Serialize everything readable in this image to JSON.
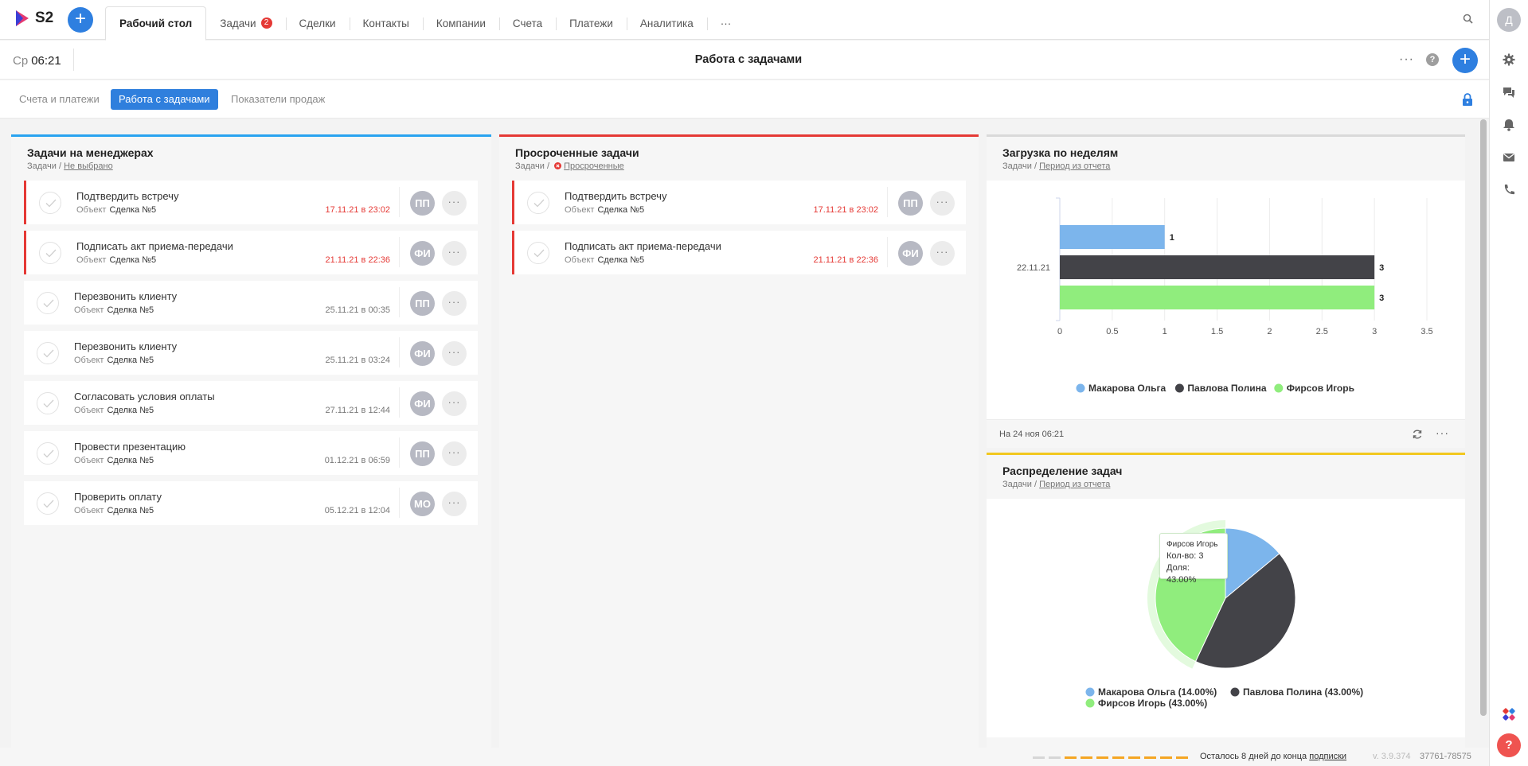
{
  "app": {
    "logo_text": "S2"
  },
  "nav": {
    "tabs": [
      {
        "label": "Рабочий стол"
      },
      {
        "label": "Задачи",
        "badge": "2"
      },
      {
        "label": "Сделки"
      },
      {
        "label": "Контакты"
      },
      {
        "label": "Компании"
      },
      {
        "label": "Счета"
      },
      {
        "label": "Платежи"
      },
      {
        "label": "Аналитика"
      },
      {
        "label": "···"
      }
    ],
    "user_initial": "Д"
  },
  "header": {
    "day": "Ср",
    "time": "06:21",
    "title": "Работа с задачами"
  },
  "subtabs": [
    "Счета и платежи",
    "Работа с задачами",
    "Показатели продаж"
  ],
  "panel_managers": {
    "title": "Задачи на менеджерах",
    "crumb": "Задачи /",
    "filter": "Не выбрано",
    "tasks": [
      {
        "name": "Подтвердить встречу",
        "obj_label": "Объект",
        "obj": "Сделка №5",
        "date": "17.11.21 в 23:02",
        "avatar": "ПП",
        "overdue": true
      },
      {
        "name": "Подписать акт приема-передачи",
        "obj_label": "Объект",
        "obj": "Сделка №5",
        "date": "21.11.21 в 22:36",
        "avatar": "ФИ",
        "overdue": true
      },
      {
        "name": "Перезвонить клиенту",
        "obj_label": "Объект",
        "obj": "Сделка №5",
        "date": "25.11.21 в 00:35",
        "avatar": "ПП",
        "overdue": false
      },
      {
        "name": "Перезвонить клиенту",
        "obj_label": "Объект",
        "obj": "Сделка №5",
        "date": "25.11.21 в 03:24",
        "avatar": "ФИ",
        "overdue": false
      },
      {
        "name": "Согласовать условия оплаты",
        "obj_label": "Объект",
        "obj": "Сделка №5",
        "date": "27.11.21 в 12:44",
        "avatar": "ФИ",
        "overdue": false
      },
      {
        "name": "Провести презентацию",
        "obj_label": "Объект",
        "obj": "Сделка №5",
        "date": "01.12.21 в 06:59",
        "avatar": "ПП",
        "overdue": false
      },
      {
        "name": "Проверить оплату",
        "obj_label": "Объект",
        "obj": "Сделка №5",
        "date": "05.12.21 в 12:04",
        "avatar": "МО",
        "overdue": false
      }
    ]
  },
  "panel_overdue": {
    "title": "Просроченные задачи",
    "crumb": "Задачи /",
    "filter": "Просроченные",
    "tasks": [
      {
        "name": "Подтвердить встречу",
        "obj_label": "Объект",
        "obj": "Сделка №5",
        "date": "17.11.21 в 23:02",
        "avatar": "ПП",
        "overdue": true
      },
      {
        "name": "Подписать акт приема-передачи",
        "obj_label": "Объект",
        "obj": "Сделка №5",
        "date": "21.11.21 в 22:36",
        "avatar": "ФИ",
        "overdue": true
      }
    ]
  },
  "panel_weekly": {
    "title": "Загрузка по неделям",
    "crumb": "Задачи /",
    "filter": "Период из отчета",
    "footer": "На 24 ноя 06:21"
  },
  "panel_dist": {
    "title": "Распределение задач",
    "crumb": "Задачи /",
    "filter": "Период из отчета",
    "tooltip": {
      "name": "Фирсов Игорь",
      "count": "Кол-во: 3",
      "share": "Доля: 43.00%"
    },
    "legend": [
      "Макарова Ольга (14.00%)",
      "Павлова Полина (43.00%)",
      "Фирсов Игорь (43.00%)"
    ]
  },
  "chart_data": [
    {
      "type": "bar",
      "orientation": "horizontal",
      "categories": [
        "22.11.21"
      ],
      "series": [
        {
          "name": "Макарова Ольга",
          "values": [
            1
          ],
          "color": "#7cb5ec"
        },
        {
          "name": "Павлова Полина",
          "values": [
            3
          ],
          "color": "#434348"
        },
        {
          "name": "Фирсов Игорь",
          "values": [
            3
          ],
          "color": "#90ed7d"
        }
      ],
      "xlim": [
        0,
        3.5
      ],
      "xticks": [
        "0",
        "0.5",
        "1",
        "1.5",
        "2",
        "2.5",
        "3",
        "3.5"
      ],
      "grid": true,
      "legend": "bottom"
    },
    {
      "type": "pie",
      "labels": [
        "Макарова Ольга",
        "Павлова Полина",
        "Фирсов Игорь"
      ],
      "values": [
        14,
        43,
        43
      ],
      "colors": [
        "#7cb5ec",
        "#434348",
        "#90ed7d"
      ],
      "legend": "bottom"
    }
  ],
  "status": {
    "days_left": "Осталось 8 дней до конца",
    "subscription": "подписки",
    "version": "v. 3.9.374",
    "account": "37761-78575"
  },
  "colors": {
    "accent": "#2e7fe0",
    "danger": "#e53935"
  }
}
